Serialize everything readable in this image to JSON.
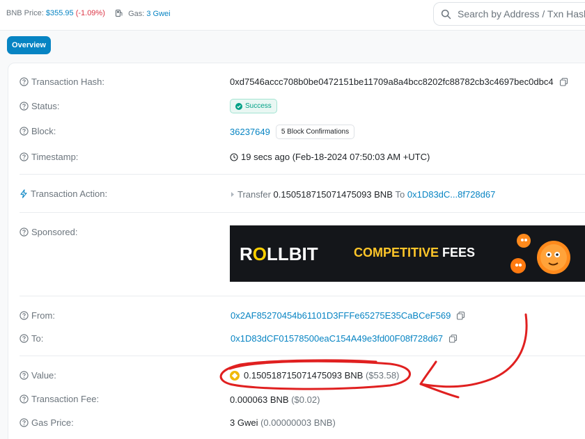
{
  "topbar": {
    "price_label": "BNB Price:",
    "price_value": "$355.95",
    "price_change": "(-1.09%)",
    "gas_label": "Gas:",
    "gas_value": "3 Gwei",
    "search_placeholder": "Search by Address / Txn Hash"
  },
  "tabs": {
    "overview": "Overview"
  },
  "details": {
    "tx_hash": {
      "label": "Transaction Hash:",
      "value": "0xd7546accc708b0be0472151be11709a8a4bcc8202fc88782cb3c4697bec0dbc4"
    },
    "status": {
      "label": "Status:",
      "value": "Success"
    },
    "block": {
      "label": "Block:",
      "value": "36237649",
      "confirmations": "5 Block Confirmations"
    },
    "timestamp": {
      "label": "Timestamp:",
      "value": "19 secs ago (Feb-18-2024 07:50:03 AM +UTC)"
    },
    "action": {
      "label": "Transaction Action:",
      "verb": "Transfer",
      "amount": "0.150518715071475093 BNB",
      "to_word": "To",
      "to_address": "0x1D83dC...8f728d67"
    },
    "sponsored": {
      "label": "Sponsored:",
      "brand_pre": "R",
      "brand_o": "O",
      "brand_post": "LLBIT",
      "tag_a": "COMPETITIVE",
      "tag_b": "FEES"
    },
    "from": {
      "label": "From:",
      "value": "0x2AF85270454b61101D3FFFe65275E35CaBCeF569"
    },
    "to": {
      "label": "To:",
      "value": "0x1D83dCF01578500eaC154A49e3fd00F08f728d67"
    },
    "value": {
      "label": "Value:",
      "amount": "0.150518715071475093 BNB",
      "usd": "($53.58)"
    },
    "fee": {
      "label": "Transaction Fee:",
      "amount": "0.000063 BNB",
      "usd": "($0.02)"
    },
    "gas_price": {
      "label": "Gas Price:",
      "amount": "3 Gwei",
      "bnb": "(0.00000003 BNB)"
    }
  },
  "colors": {
    "accent": "#0784c3",
    "success": "#00a186",
    "negative": "#dc3545",
    "annotation": "#e02020"
  }
}
